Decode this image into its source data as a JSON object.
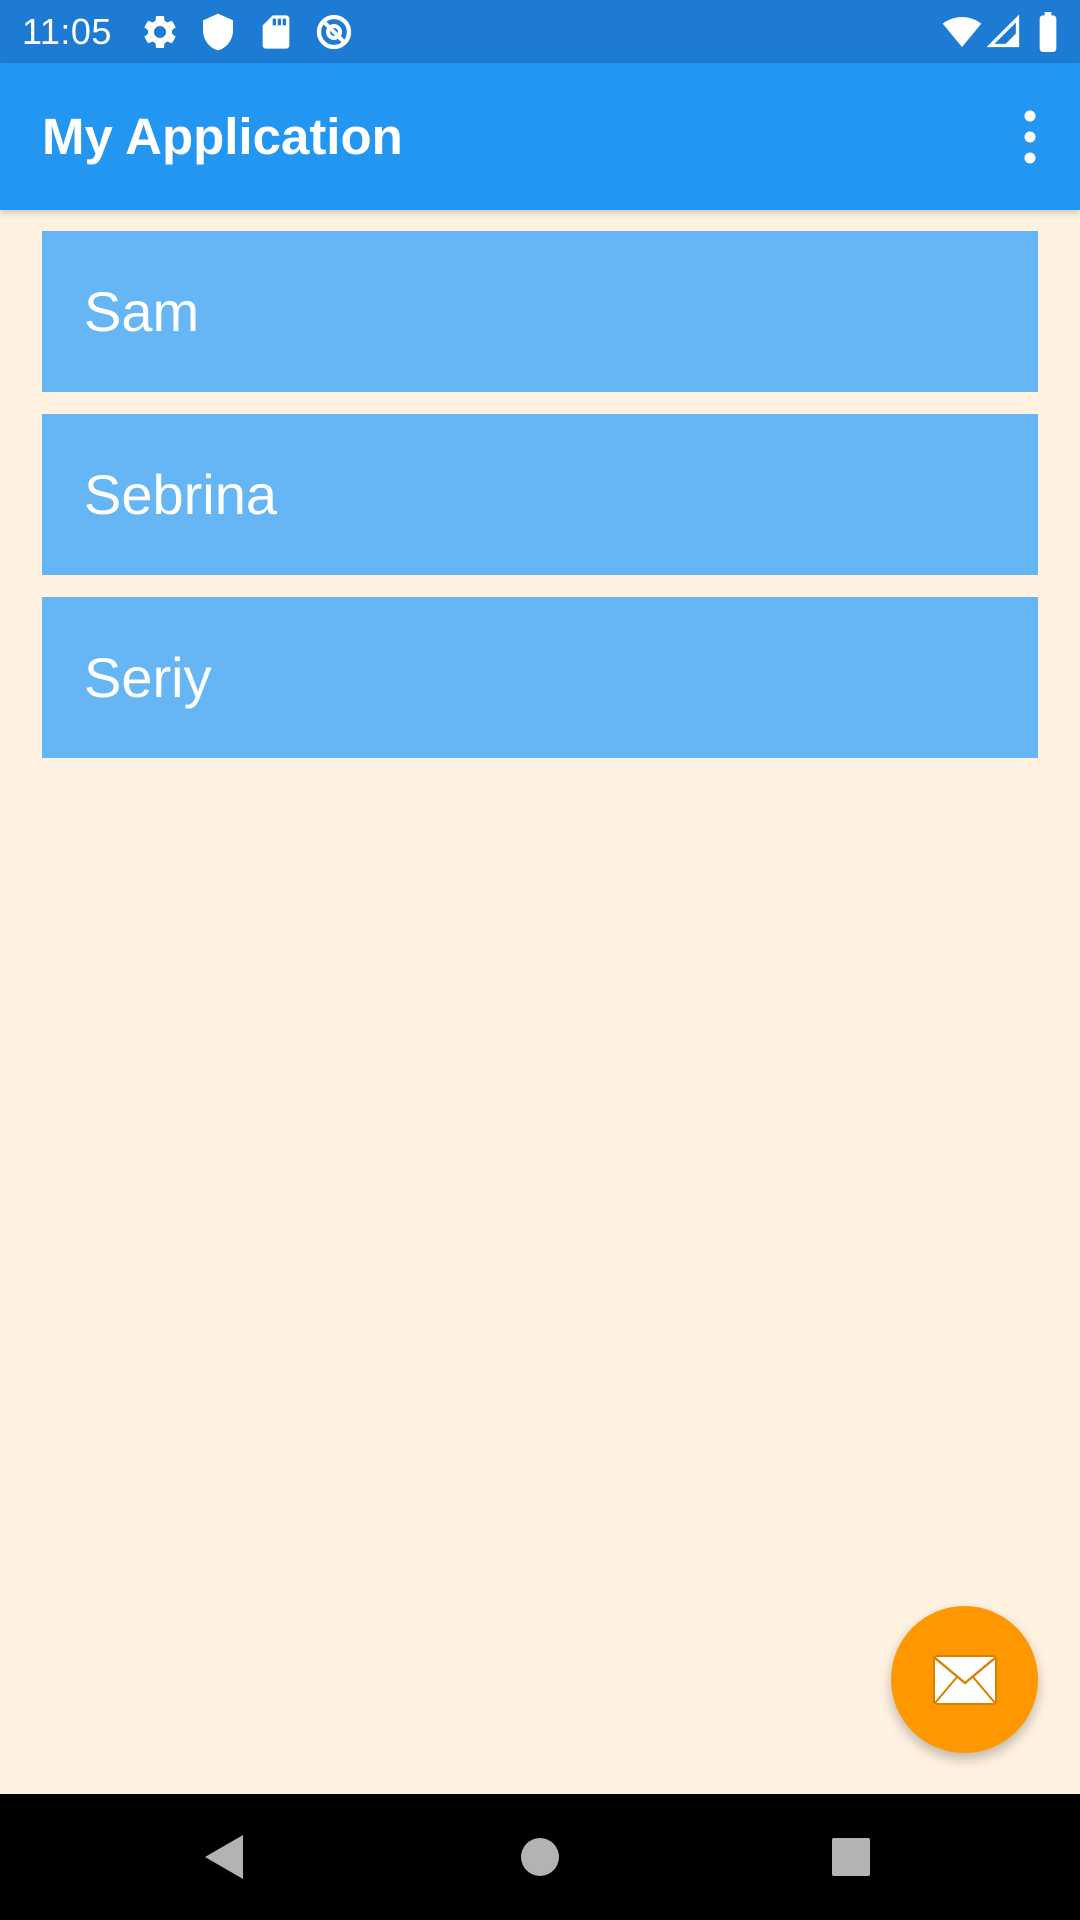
{
  "status_bar": {
    "time": "11:05",
    "left_icons": [
      "gear-icon",
      "shield-icon",
      "sd-card-icon",
      "at-sign-icon"
    ],
    "right_icons": [
      "wifi-icon",
      "cell-signal-icon",
      "battery-icon"
    ]
  },
  "app_bar": {
    "title": "My Application",
    "overflow_icon": "more-vert-icon"
  },
  "list": {
    "items": [
      {
        "label": "Sam"
      },
      {
        "label": "Sebrina"
      },
      {
        "label": "Seriy"
      }
    ]
  },
  "fab": {
    "icon": "email-icon",
    "color": "#ff9800"
  },
  "nav_bar": {
    "buttons": [
      "back-icon",
      "home-icon",
      "recents-icon"
    ]
  },
  "colors": {
    "status_bar": "#1e7bd3",
    "app_bar": "#2396f2",
    "list_item": "#66b6f5",
    "background": "#fff2e1"
  }
}
